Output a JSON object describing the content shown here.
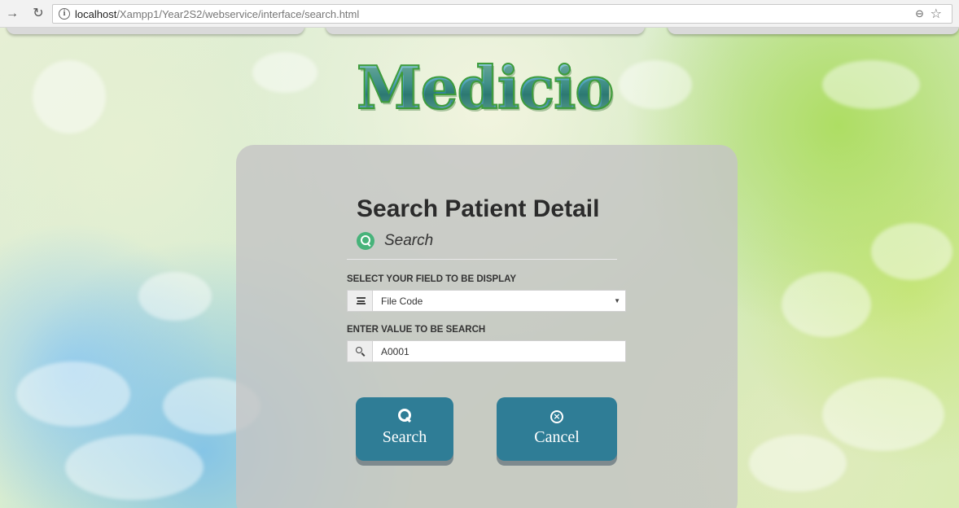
{
  "browser": {
    "url_host": "localhost",
    "url_path": "/Xampp1/Year2S2/webservice/interface/search.html"
  },
  "logo": {
    "text": "Medicio"
  },
  "panel": {
    "title": "Search Patient Detail",
    "subtitle": "Search",
    "select_label": "SELECT YOUR FIELD TO BE DISPLAY",
    "select_value": "File Code",
    "input_label": "ENTER VALUE TO BE SEARCH",
    "input_value": "A0001",
    "search_button": "Search",
    "cancel_button": "Cancel"
  },
  "colors": {
    "button": "#2f7d96",
    "subtitle_icon": "#47b37a"
  }
}
